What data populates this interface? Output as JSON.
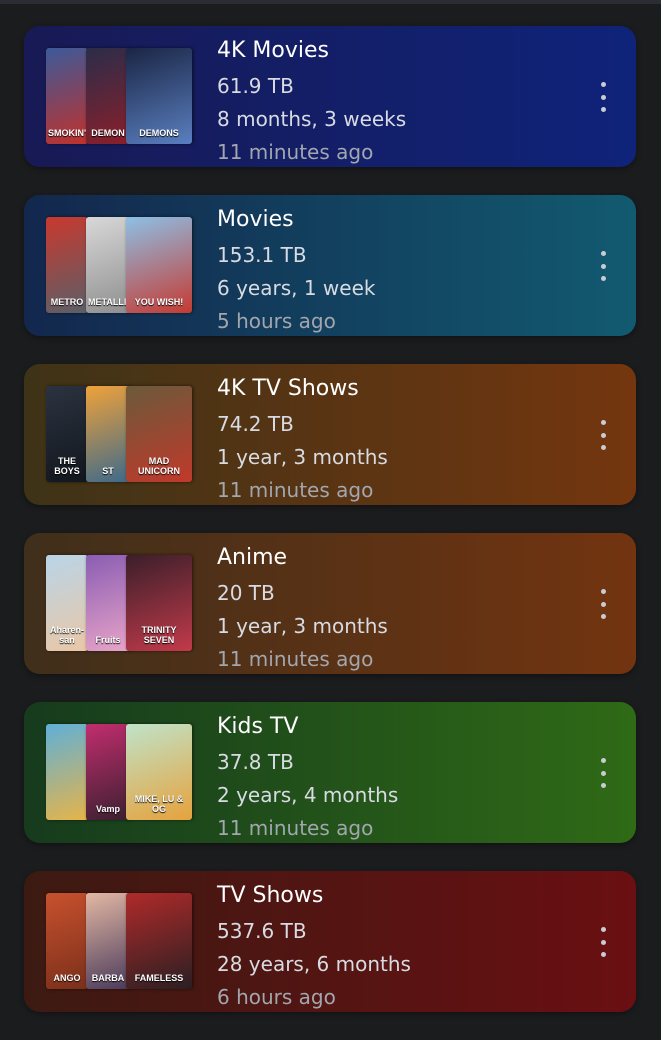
{
  "libraries": [
    {
      "name": "4K Movies",
      "size": "61.9 TB",
      "duration": "8 months, 3 weeks",
      "updated": "11 minutes ago",
      "gradient": [
        "#181a55",
        "#0f237a"
      ],
      "posters": [
        {
          "caption": "SMOKIN'",
          "colors": [
            "#3b5a9a",
            "#c0312b"
          ]
        },
        {
          "caption": "DEMON",
          "colors": [
            "#2a2d4a",
            "#8a1f2a"
          ]
        },
        {
          "caption": "DEMONS",
          "colors": [
            "#1a2544",
            "#5a7fc0"
          ]
        }
      ]
    },
    {
      "name": "Movies",
      "size": "153.1 TB",
      "duration": "6 years, 1 week",
      "updated": "5 hours ago",
      "gradient": [
        "#13274d",
        "#125a70"
      ],
      "posters": [
        {
          "caption": "METRO",
          "colors": [
            "#c9392e",
            "#5a5f68"
          ]
        },
        {
          "caption": "METALLICA",
          "colors": [
            "#d8d8d8",
            "#8f8f8f"
          ]
        },
        {
          "caption": "YOU WISH!",
          "colors": [
            "#8dc0e6",
            "#c53a31"
          ]
        }
      ]
    },
    {
      "name": "4K TV Shows",
      "size": "74.2 TB",
      "duration": "1 year, 3 months",
      "updated": "11 minutes ago",
      "gradient": [
        "#3e3317",
        "#74360f"
      ],
      "posters": [
        {
          "caption": "THE BOYS",
          "colors": [
            "#2b3340",
            "#12161d"
          ]
        },
        {
          "caption": "ST",
          "colors": [
            "#f0a23a",
            "#3d6a8a"
          ]
        },
        {
          "caption": "MAD UNICORN",
          "colors": [
            "#6b5a3a",
            "#c0392b"
          ]
        }
      ]
    },
    {
      "name": "Anime",
      "size": "20 TB",
      "duration": "1 year, 3 months",
      "updated": "11 minutes ago",
      "gradient": [
        "#3f2f1b",
        "#733410"
      ],
      "posters": [
        {
          "caption": "Aharen-san",
          "colors": [
            "#b9d5e8",
            "#e9c7a6"
          ]
        },
        {
          "caption": "Fruits",
          "colors": [
            "#8a5db3",
            "#e8a4c8"
          ]
        },
        {
          "caption": "TRINITY SEVEN",
          "colors": [
            "#3a1f2a",
            "#c23a4a"
          ]
        }
      ]
    },
    {
      "name": "Kids TV",
      "size": "37.8 TB",
      "duration": "2 years, 4 months",
      "updated": "11 minutes ago",
      "gradient": [
        "#163b1d",
        "#2f6a16"
      ],
      "posters": [
        {
          "caption": "",
          "colors": [
            "#5fb0d8",
            "#e6b448"
          ]
        },
        {
          "caption": "Vamp",
          "colors": [
            "#c22d6e",
            "#3a2030"
          ]
        },
        {
          "caption": "MIKE, LU & OG",
          "colors": [
            "#bfe3c9",
            "#e6a23c"
          ]
        }
      ]
    },
    {
      "name": "TV Shows",
      "size": "537.6 TB",
      "duration": "28 years, 6 months",
      "updated": "6 hours ago",
      "gradient": [
        "#3c1a12",
        "#6a0f12"
      ],
      "posters": [
        {
          "caption": "ANGO",
          "colors": [
            "#c8512e",
            "#7a2f1a"
          ]
        },
        {
          "caption": "BARBA",
          "colors": [
            "#e3b8a4",
            "#4a3a5a"
          ]
        },
        {
          "caption": "FAMELESS",
          "colors": [
            "#b02a2a",
            "#2a1f22"
          ]
        }
      ]
    }
  ]
}
